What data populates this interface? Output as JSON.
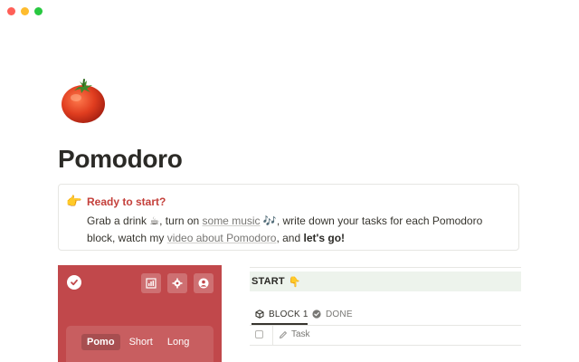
{
  "window": {
    "controls": [
      "close",
      "minimize",
      "zoom"
    ]
  },
  "page": {
    "icon": "tomato-icon",
    "title": "Pomodoro"
  },
  "callout": {
    "icon": "pointing-right-icon",
    "title": "Ready to start?",
    "body_1": "Grab a drink",
    "drink_icon": "☕",
    "body_2": ", turn on",
    "music_link": "some music",
    "music_icon": "🎶",
    "body_3": ", write down your tasks for each Pomodoro block, watch my",
    "video_link": "video about Pomodoro",
    "body_4": ", and",
    "lets_go": "let's go!"
  },
  "timer": {
    "background_color": "#c1484b",
    "icons": [
      "checkmark-icon",
      "stats-icon",
      "settings-icon",
      "account-icon"
    ],
    "modes": [
      "Pomo",
      "Short",
      "Long"
    ],
    "active_mode": "Pomo"
  },
  "start": {
    "label": "START",
    "emoji": "👇",
    "background_color": "#edf3ec"
  },
  "tabs": {
    "block": "BLOCK 1",
    "done": "DONE"
  },
  "table": {
    "task_column": "Task"
  }
}
